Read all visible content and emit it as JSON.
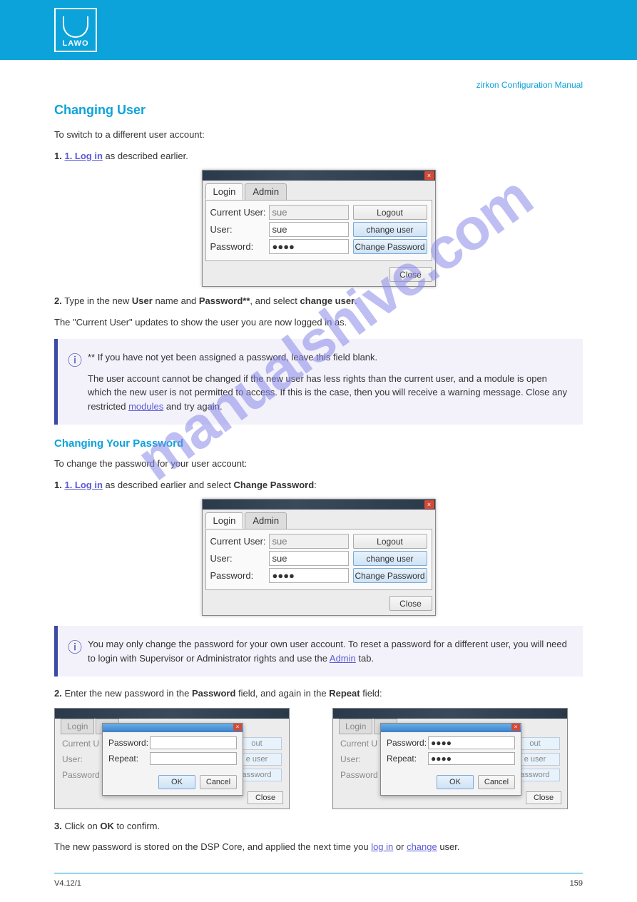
{
  "header": {
    "logo_text": "LAWO",
    "right_head": "zirkon Configuration Manual"
  },
  "sections": {
    "change_user_title": "Changing User",
    "change_user_intro": "To switch to a different user account:",
    "step1_prefix": "1. Log in",
    "step1_rest": " as described earlier.",
    "dialog": {
      "tab_login": "Login",
      "tab_admin": "Admin",
      "label_current": "Current User:",
      "val_current": "sue",
      "btn_logout": "Logout",
      "label_user": "User:",
      "val_user": "sue",
      "btn_change_user": "change user",
      "label_password": "Password:",
      "val_password_masked": "●●●●",
      "btn_change_pw": "Change Password",
      "btn_close": "Close"
    },
    "step2_prefix": "2.",
    "step2_rest": "Type in the new ",
    "step2_bold1": "User",
    "step2_mid": " name and ",
    "step2_bold2": "Password**",
    "step2_rest2": ", and select ",
    "step2_bold3": "change user",
    "step2_end": ".",
    "step2_desc": "The \"Current User\" updates to show the user you are now logged in as.",
    "note1_p1": "** If you have not yet been assigned a password, leave this field blank.",
    "note1_p2_1": "The user account cannot be changed if the new user has less rights than the current user, and a module is open which the new user is not permitted to access. If this is the case, then you will receive a warning message. Close any restricted ",
    "note1_link": "modules",
    "note1_p2_2": " and try again.",
    "change_pw_title": "Changing Your Password",
    "change_pw_intro": "To change the password for your user account:",
    "step_pw1_prefix": "1. Log in",
    "step_pw1_rest": " as described earlier and select ",
    "step_pw1_bold": "Change Password",
    "step_pw1_end": ":",
    "note2_p1": "You may only change the password for your own user account. To reset a password for a different user, you will need to login with Supervisor or Administrator rights and use the ",
    "note2_link": "Admin",
    "note2_p2": " tab.",
    "step_pw2_prefix": "2.",
    "step_pw2_rest": "Enter the new password in the ",
    "step_pw2_bold1": "Password",
    "step_pw2_mid": " field, and again in the ",
    "step_pw2_bold2": "Repeat",
    "step_pw2_end": " field:",
    "mini_dialog": {
      "tab_login": "Login",
      "tab_admin": "Ad",
      "label_current": "Current U",
      "label_user": "User:",
      "label_password": "Password",
      "bg_btn1": "out",
      "bg_btn2": "e user",
      "bg_btn3": "assword",
      "close": "Close",
      "ov_label_pw": "Password:",
      "ov_label_rp": "Repeat:",
      "ov_val_dots": "●●●●",
      "ov_ok": "OK",
      "ov_cancel": "Cancel"
    },
    "step_pw3_prefix": "3.",
    "step_pw3_rest": "Click on ",
    "step_pw3_bold": "OK",
    "step_pw3_end": " to confirm.",
    "desc_pw_end1": "The new password is stored on the DSP Core, and applied the next time you ",
    "desc_pw_link1": "log in",
    "desc_pw_mid": " or ",
    "desc_pw_link2": "change",
    "desc_pw_end2": " user."
  },
  "footer": {
    "left": "V4.12/1",
    "right": "159"
  },
  "watermark": "manualshive.com"
}
